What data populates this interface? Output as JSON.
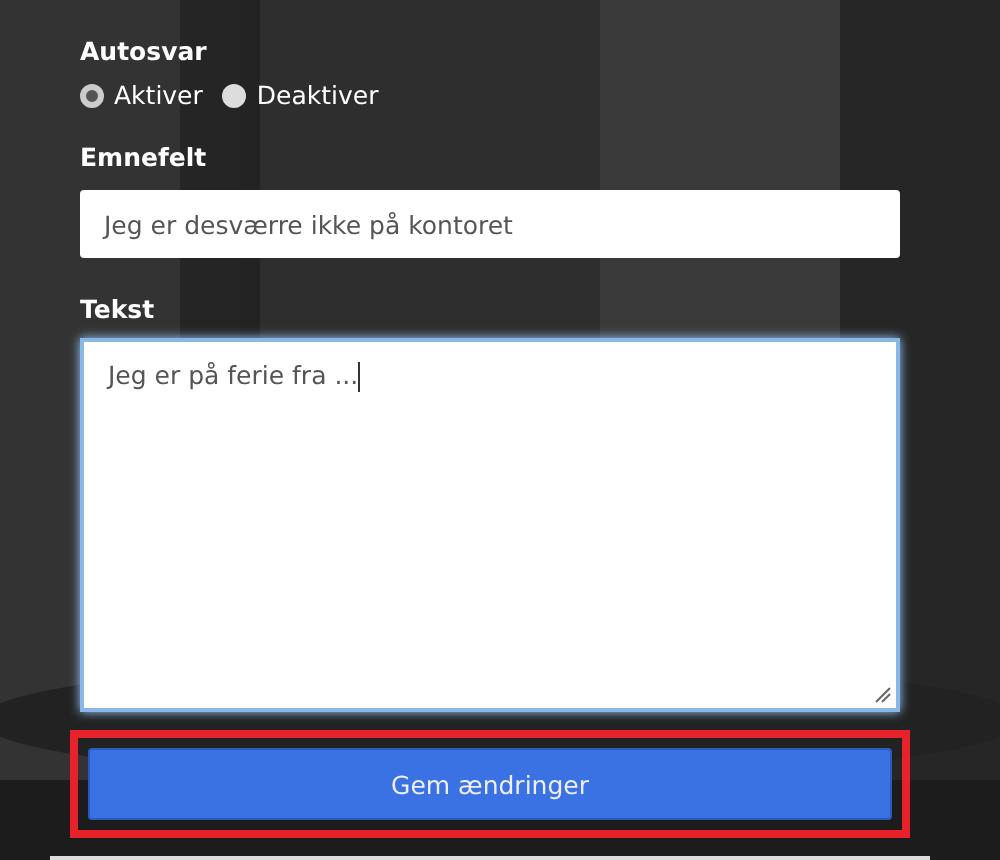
{
  "autoreply": {
    "label": "Autosvar",
    "options": [
      {
        "label": "Aktiver",
        "selected": true
      },
      {
        "label": "Deaktiver",
        "selected": false
      }
    ]
  },
  "subject": {
    "label": "Emnefelt",
    "value": "Jeg er desværre ikke på kontoret"
  },
  "body": {
    "label": "Tekst",
    "value": "Jeg er på ferie fra ...",
    "focused": true
  },
  "save_button": {
    "label": "Gem ændringer",
    "highlighted": true
  }
}
